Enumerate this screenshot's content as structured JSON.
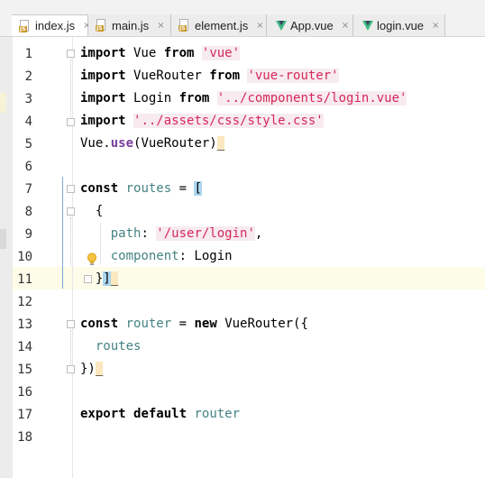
{
  "tabs": [
    {
      "label": "index.js",
      "icon": "js-file-icon",
      "active": true
    },
    {
      "label": "main.js",
      "icon": "js-file-icon",
      "active": false
    },
    {
      "label": "element.js",
      "icon": "js-file-icon",
      "active": false
    },
    {
      "label": "App.vue",
      "icon": "vue-file-icon",
      "active": false
    },
    {
      "label": "login.vue",
      "icon": "vue-file-icon",
      "active": false
    }
  ],
  "close_glyph": "×",
  "line_numbers": [
    "1",
    "2",
    "3",
    "4",
    "5",
    "6",
    "7",
    "8",
    "9",
    "10",
    "11",
    "12",
    "13",
    "14",
    "15",
    "16",
    "17",
    "18"
  ],
  "code": {
    "l1": {
      "kw1": "import",
      "t1": " Vue ",
      "kw2": "from",
      "t2": " ",
      "s": "'vue'"
    },
    "l2": {
      "kw1": "import",
      "t1": " VueRouter ",
      "kw2": "from",
      "t2": " ",
      "s": "'vue-router'"
    },
    "l3": {
      "kw1": "import",
      "t1": " Login ",
      "kw2": "from",
      "t2": " ",
      "s": "'../components/login.vue'"
    },
    "l4": {
      "kw1": "import",
      "t1": " ",
      "s": "'../assets/css/style.css'"
    },
    "l5": {
      "t1": "Vue.",
      "fn": "use",
      "t2": "(VueRouter)",
      "mark": "_"
    },
    "l7": {
      "kw": "const",
      "t1": " ",
      "v": "routes",
      "t2": " = ",
      "br": "["
    },
    "l8": {
      "t1": "  {"
    },
    "l9": {
      "t1": "    ",
      "p": "path",
      "t2": ": ",
      "s": "'/user/login'",
      "t3": ","
    },
    "l10": {
      "t1": "    ",
      "p": "component",
      "t2": ": Login"
    },
    "l11": {
      "t1": "  }",
      "br": "]",
      "mark": "_"
    },
    "l13": {
      "kw": "const",
      "t1": " ",
      "v": "router",
      "t2": " = ",
      "kw2": "new",
      "t3": " VueRouter({"
    },
    "l14": {
      "t1": "  ",
      "v": "routes"
    },
    "l15": {
      "t1": "})",
      "mark": "_"
    },
    "l17": {
      "kw": "export",
      "t1": " ",
      "kw2": "default",
      "t2": " ",
      "v": "router"
    }
  },
  "colors": {
    "keyword": "#000080",
    "string": "#d6275a",
    "variable": "#458383",
    "function": "#7a3e9d",
    "current_line": "#fdfce9",
    "bracket_match": "#add7f0",
    "vue_green": "#41b883",
    "js_badge": "#c99b2e"
  }
}
